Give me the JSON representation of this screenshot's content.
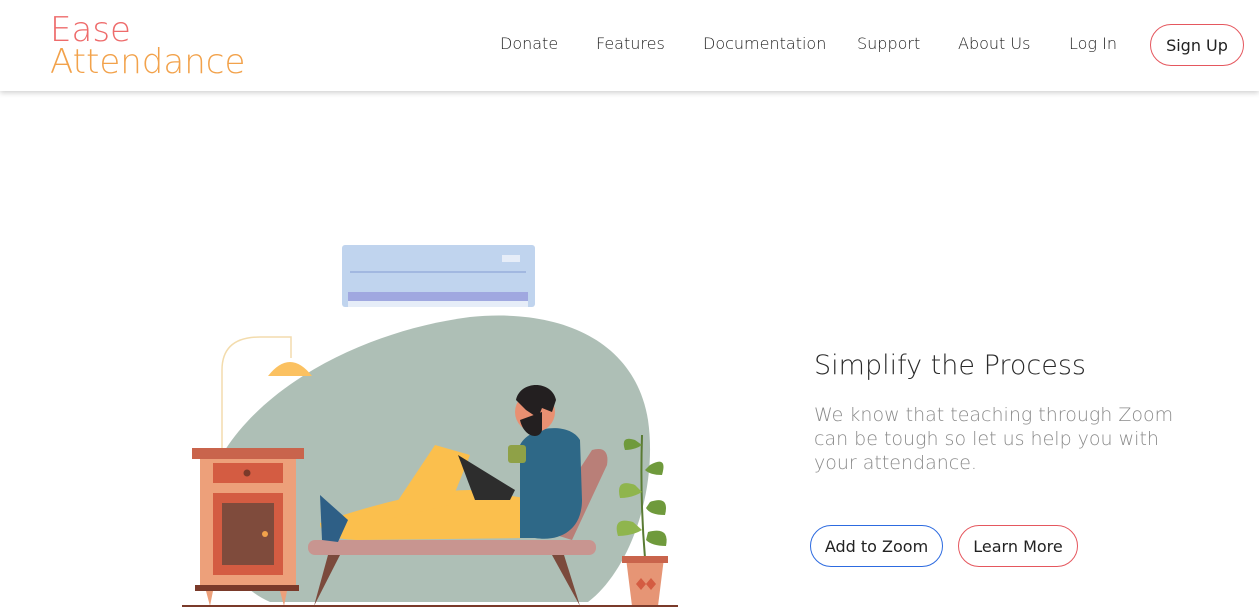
{
  "logo": {
    "line1": "Ease",
    "line2": "Attendance"
  },
  "nav": {
    "links": [
      "Donate",
      "Features",
      "Documentation",
      "Support",
      "About Us",
      "Log In"
    ],
    "signup": "Sign Up"
  },
  "hero": {
    "title": "Simplify the Process",
    "description": "We know that teaching through Zoom can be tough so let us help you with your attendance.",
    "buttons": {
      "add_to_zoom": "Add to Zoom",
      "learn_more": "Learn More"
    }
  },
  "colors": {
    "logo_primary": "#ee6b6b",
    "logo_secondary": "#f2a24b",
    "signup_border": "#e5575e",
    "zoom_border": "#2d6be0",
    "learn_border": "#e5575e"
  }
}
